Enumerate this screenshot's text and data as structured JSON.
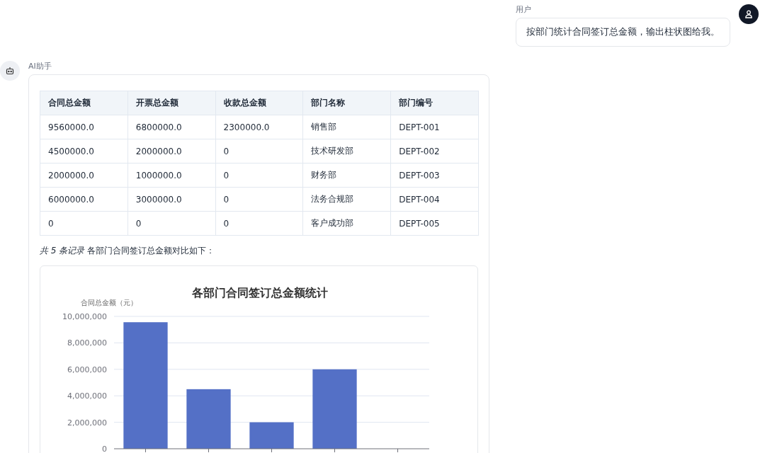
{
  "user_message": {
    "sender": "用户",
    "text": "按部门统计合同签订总金额，输出柱状图给我。"
  },
  "assistant_message": {
    "sender": "AI助手",
    "table": {
      "columns": [
        "合同总金额",
        "开票总金额",
        "收款总金额",
        "部门名称",
        "部门编号"
      ],
      "rows": [
        [
          "9560000.0",
          "6800000.0",
          "2300000.0",
          "销售部",
          "DEPT-001"
        ],
        [
          "4500000.0",
          "2000000.0",
          "0",
          "技术研发部",
          "DEPT-002"
        ],
        [
          "2000000.0",
          "1000000.0",
          "0",
          "财务部",
          "DEPT-003"
        ],
        [
          "6000000.0",
          "3000000.0",
          "0",
          "法务合规部",
          "DEPT-004"
        ],
        [
          "0",
          "0",
          "0",
          "客户成功部",
          "DEPT-005"
        ]
      ]
    },
    "caption": "*共 5 条记录* 各部门合同签订总金额对比如下：",
    "chart_data": {
      "type": "bar",
      "title": "各部门合同签订总金额统计",
      "ylabel": "合同总金额（元）",
      "values": [
        9560000,
        4500000,
        2000000,
        6000000,
        0
      ],
      "grid": true,
      "ylim": [
        0,
        10000000
      ],
      "yticks": [
        {
          "value": 0,
          "label": "0"
        },
        {
          "value": 2000000,
          "label": "2,000,000"
        },
        {
          "value": 4000000,
          "label": "4,000,000"
        },
        {
          "value": 6000000,
          "label": "6,000,000"
        },
        {
          "value": 8000000,
          "label": "8,000,000"
        },
        {
          "value": 10000000,
          "label": "10,000,000"
        }
      ]
    }
  }
}
